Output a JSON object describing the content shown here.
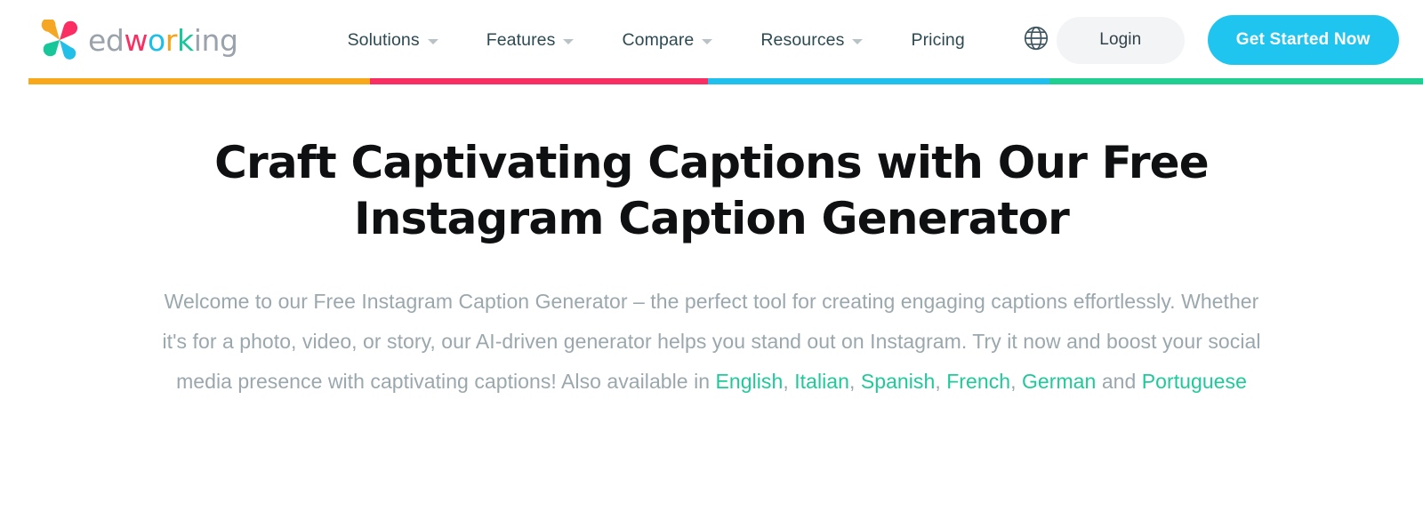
{
  "brand": {
    "logo_icon": "edworking-pinwheel-logo",
    "wordmark_segments": [
      {
        "text": "ed",
        "color": "#9aa2ab"
      },
      {
        "text": "w",
        "color": "#fb2e63"
      },
      {
        "text": "o",
        "color": "#1bbfe9"
      },
      {
        "text": "r",
        "color": "#f6a416"
      },
      {
        "text": "k",
        "color": "#19c79a"
      },
      {
        "text": "ing",
        "color": "#9aa2ab"
      }
    ],
    "petal_colors": {
      "top_left": "#f5a623",
      "top_right": "#fb2e63",
      "bottom_left": "#17c79a",
      "bottom_right": "#22bfe8"
    }
  },
  "header": {
    "nav": [
      {
        "label": "Solutions",
        "has_dropdown": true
      },
      {
        "label": "Features",
        "has_dropdown": true
      },
      {
        "label": "Compare",
        "has_dropdown": true
      },
      {
        "label": "Resources",
        "has_dropdown": true
      },
      {
        "label": "Pricing",
        "has_dropdown": false
      }
    ],
    "language_icon": "globe-icon",
    "login_label": "Login",
    "cta_label": "Get Started Now",
    "cta_color": "#20c5ef",
    "login_bg": "#f2f4f5"
  },
  "accent_bar": [
    {
      "color": "#f8a81b",
      "width_pct": 24.5
    },
    {
      "color": "#f92e63",
      "width_pct": 24.2
    },
    {
      "color": "#1fc0ee",
      "width_pct": 24.5
    },
    {
      "color": "#1fcf92",
      "width_pct": 26.8
    }
  ],
  "hero": {
    "headline": "Craft Captivating Captions with Our Free Instagram Caption Generator",
    "paragraph_parts": [
      {
        "text": "Welcome to our Free Instagram Caption Generator – the perfect tool for creating engaging captions effortlessly. Whether it's for a photo, video, or story, our AI-driven generator helps you stand out on Instagram. Try it now and boost your social media presence with captivating captions! Also available in ",
        "link": false
      },
      {
        "text": "English",
        "link": true
      },
      {
        "text": ", ",
        "link": false
      },
      {
        "text": "Italian",
        "link": true
      },
      {
        "text": ", ",
        "link": false
      },
      {
        "text": "Spanish",
        "link": true
      },
      {
        "text": ", ",
        "link": false
      },
      {
        "text": "French",
        "link": true
      },
      {
        "text": ", ",
        "link": false
      },
      {
        "text": "German",
        "link": true
      },
      {
        "text": " and ",
        "link": false
      },
      {
        "text": "Portuguese",
        "link": true
      }
    ],
    "link_color": "#1fc99a",
    "text_color": "#9aa8ae"
  }
}
